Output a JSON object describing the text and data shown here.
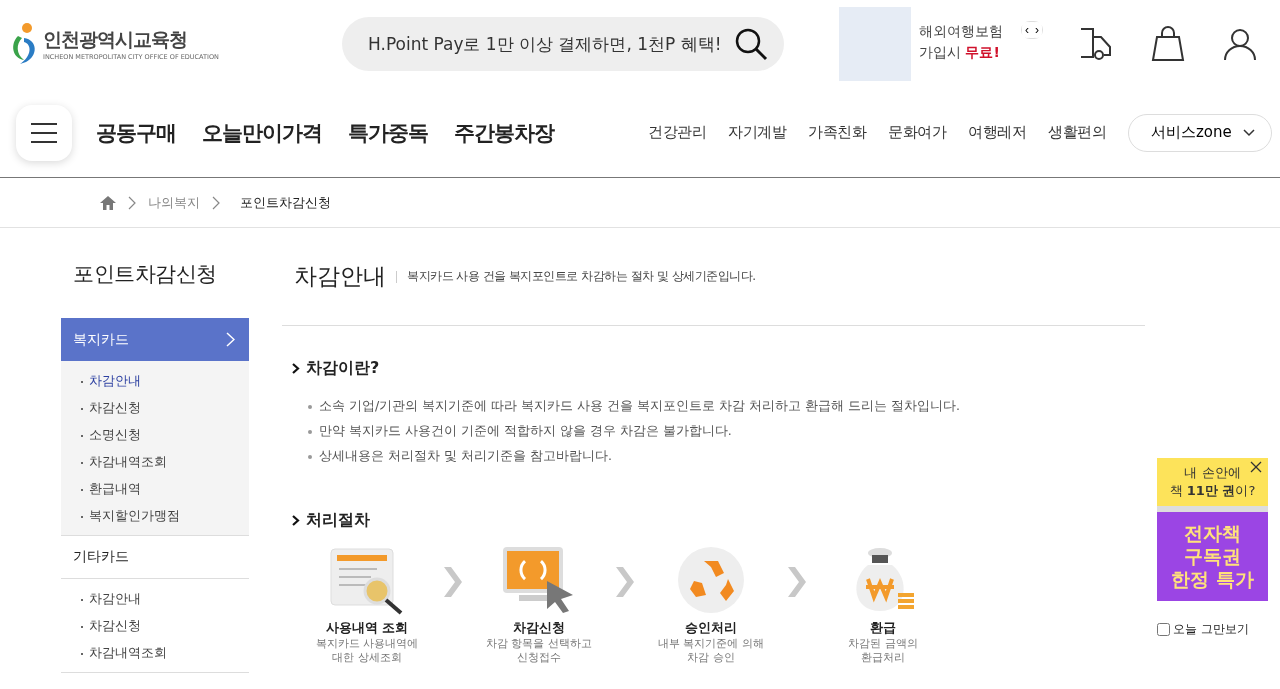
{
  "header": {
    "logo": {
      "name": "인천광역시교육청",
      "subtitle": "INCHEON METROPOLITAN CITY OFFICE OF EDUCATION"
    },
    "search": {
      "placeholder": "H.Point Pay로 1만 이상 결제하면, 1천P 혜택!"
    },
    "promo": {
      "line1": "해외여행보험",
      "line2": "가입시",
      "highlight": "무료!",
      "prev": "‹",
      "next": "›"
    }
  },
  "nav": {
    "primary": [
      "공동구매",
      "오늘만이가격",
      "특가중독",
      "주간봉차장"
    ],
    "secondary": [
      "건강관리",
      "자기계발",
      "가족친화",
      "문화여가",
      "여행레저",
      "생활편의"
    ],
    "service_zone": "서비스zone"
  },
  "breadcrumb": [
    "나의복지",
    "포인트차감신청"
  ],
  "sidebar": {
    "title": "포인트차감신청",
    "groups": [
      {
        "label": "복지카드",
        "selected": true,
        "items": [
          {
            "label": "차감안내",
            "selected": true
          },
          {
            "label": "차감신청",
            "selected": false
          },
          {
            "label": "소명신청",
            "selected": false
          },
          {
            "label": "차감내역조회",
            "selected": false
          },
          {
            "label": "환급내역",
            "selected": false
          },
          {
            "label": "복지할인가맹점",
            "selected": false
          }
        ]
      },
      {
        "label": "기타카드",
        "selected": false,
        "items": [
          {
            "label": "차감안내",
            "selected": false
          },
          {
            "label": "차감신청",
            "selected": false
          },
          {
            "label": "차감내역조회",
            "selected": false
          }
        ]
      }
    ]
  },
  "content": {
    "title": "차감안내",
    "description": "복지카드 사용 건을 복지포인트로 차감하는 절차 및 상세기준입니다.",
    "intro": {
      "heading": "차감이란?",
      "bullets": [
        "소속 기업/기관의 복지기준에 따라 복지카드 사용 건을 복지포인트로 차감 처리하고 환급해 드리는 절차입니다.",
        "만약 복지카드 사용건이 기준에 적합하지 않을 경우 차감은 불가합니다.",
        "상세내용은 처리절차 및 처리기준을 참고바랍니다."
      ]
    },
    "process": {
      "heading": "처리절차",
      "steps": [
        {
          "kind": "document",
          "title": "사용내역 조회",
          "description": [
            "복지카드 사용내역에",
            "대한 상세조회"
          ]
        },
        {
          "kind": "monitor",
          "title": "차감신청",
          "description": [
            "차감 항목을 선택하고",
            "신청접수"
          ]
        },
        {
          "kind": "recycle",
          "title": "승인처리",
          "description": [
            "내부 복지기준에 의해",
            "차감 승인"
          ]
        },
        {
          "kind": "moneybag",
          "title": "환급",
          "description": [
            "차감된 금액의",
            "환급처리"
          ]
        }
      ]
    }
  },
  "popup": {
    "lines": [
      "내 손안에",
      "책 **11만 권**이?"
    ],
    "headline": [
      "전자책",
      "구독권",
      "한정 특가"
    ],
    "dismiss": {
      "label": "오늘 그만보기",
      "checked": false
    }
  }
}
